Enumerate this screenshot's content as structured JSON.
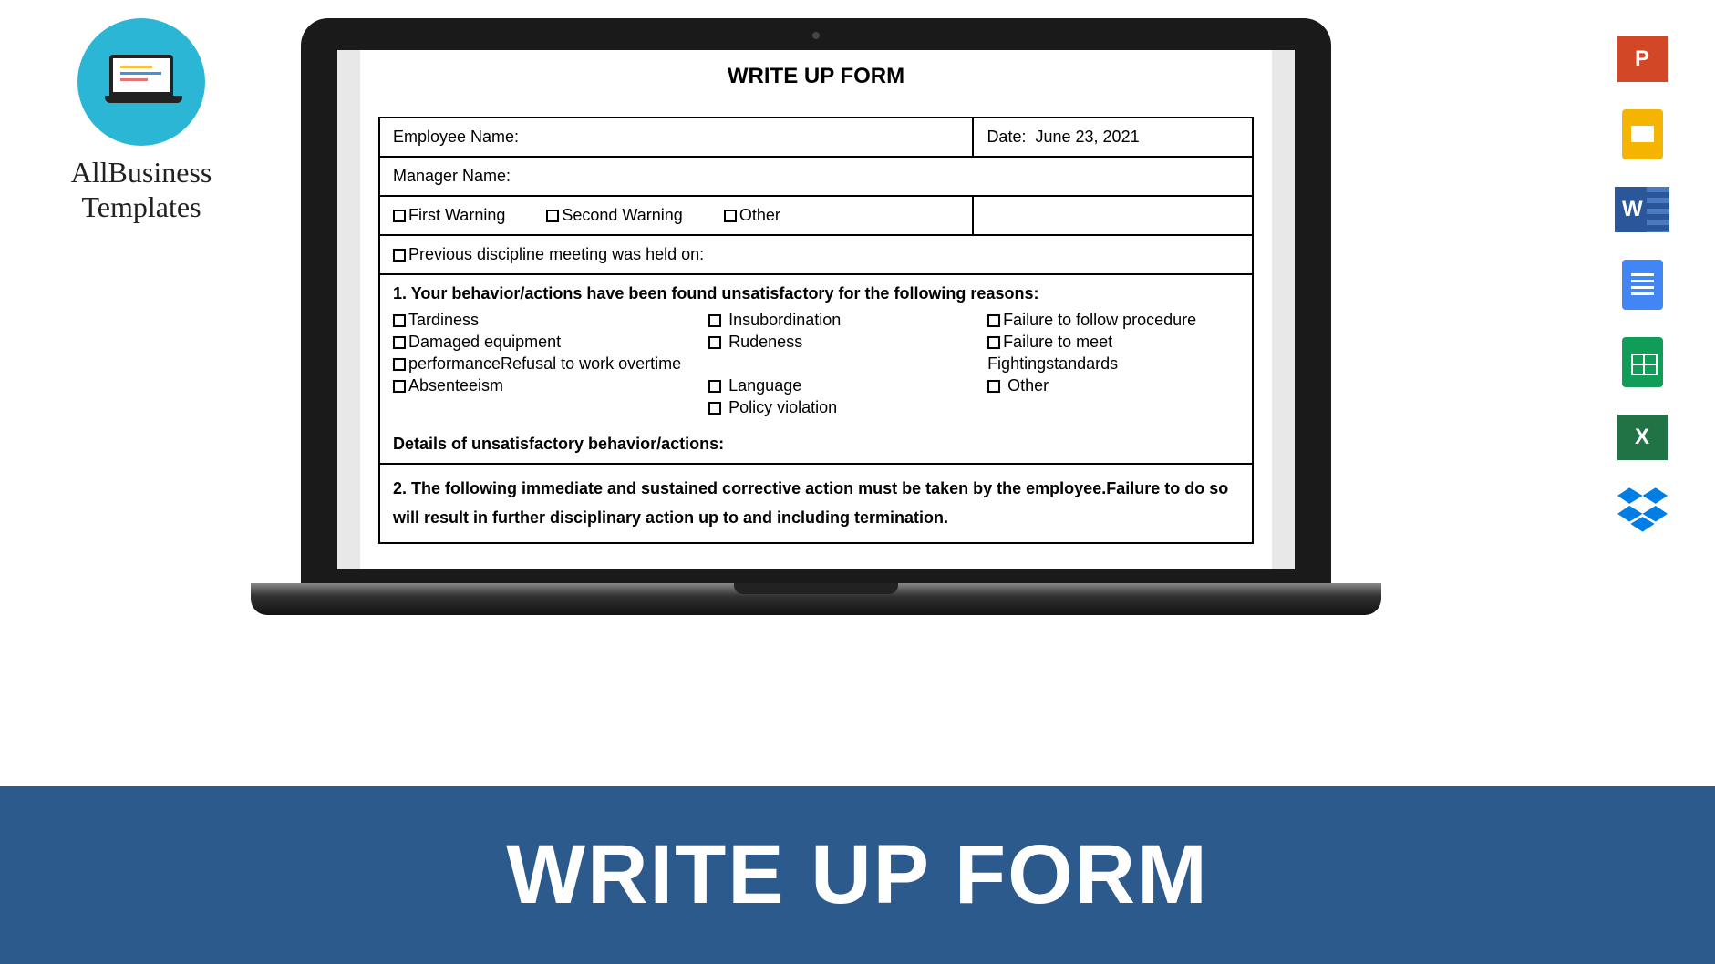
{
  "brand": {
    "line1": "AllBusiness",
    "line2": "Templates"
  },
  "bottom_title": "WRITE UP FORM",
  "form": {
    "title": "WRITE UP FORM",
    "employee_label": "Employee Name:",
    "date_label": "Date:",
    "date_value": "June 23, 2021",
    "manager_label": "Manager Name:",
    "warning1": "First Warning",
    "warning2": "Second Warning",
    "warning3": "Other",
    "previous": "Previous discipline meeting was held on:",
    "section1": "1. Your behavior/actions have been found unsatisfactory for the following reasons:",
    "reasons": {
      "c1a": "Tardiness",
      "c1b": "Damaged equipment",
      "c1c": "performanceRefusal to work overtime",
      "c1d": "Absenteeism",
      "c2a": "Insubordination",
      "c2b": "Rudeness",
      "c2c": "Language",
      "c2d": "Policy violation",
      "c3a": "Failure to follow procedure",
      "c3b": "Failure to meet",
      "c3c": "Fightingstandards",
      "c3d": "Other"
    },
    "details_label": "Details of unsatisfactory behavior/actions:",
    "section2": "2. The following immediate and sustained corrective action must be taken by the employee.Failure to do so will result in further disciplinary action up to and including termination."
  },
  "icons": {
    "ppt": "PowerPoint",
    "slides": "Google Slides",
    "word": "Word",
    "docs": "Google Docs",
    "sheets": "Google Sheets",
    "excel": "Excel",
    "dropbox": "Dropbox"
  }
}
